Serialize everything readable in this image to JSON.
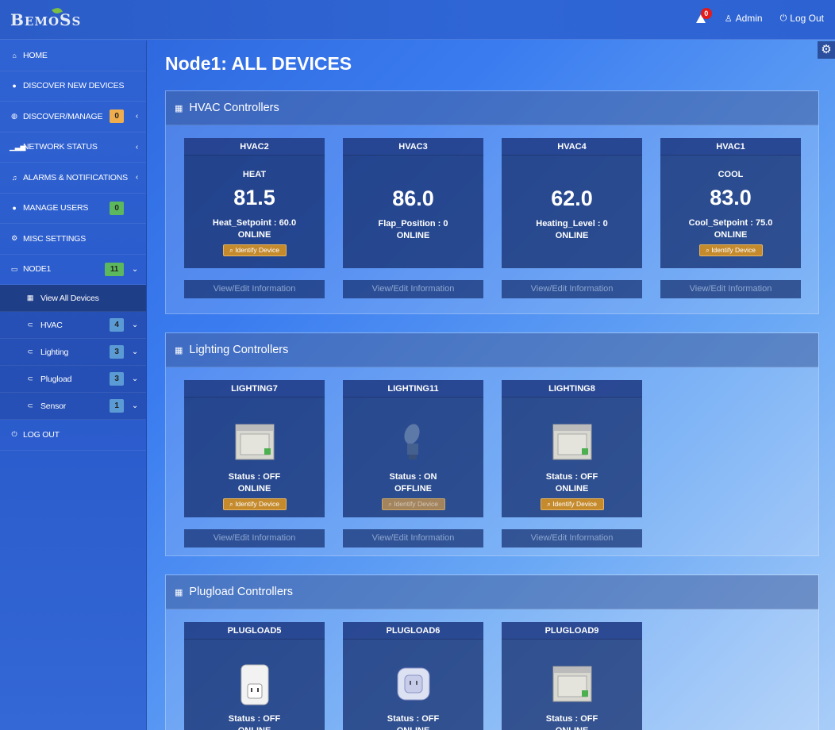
{
  "app": {
    "logo": "BEMOSS",
    "alerts_count": "0",
    "user_label": "Admin",
    "logout_label": "Log Out"
  },
  "sidebar": {
    "items": [
      {
        "label": "HOME"
      },
      {
        "label": "DISCOVER NEW DEVICES"
      },
      {
        "label": "DISCOVER/MANAGE",
        "badge": "0"
      },
      {
        "label": "NETWORK STATUS"
      },
      {
        "label": "ALARMS & NOTIFICATIONS"
      },
      {
        "label": "MANAGE USERS",
        "badge": "0"
      },
      {
        "label": "MISC SETTINGS"
      },
      {
        "label": "NODE1",
        "badge": "11"
      }
    ],
    "sub": [
      {
        "label": "View All Devices"
      },
      {
        "label": "HVAC",
        "badge": "4"
      },
      {
        "label": "Lighting",
        "badge": "3"
      },
      {
        "label": "Plugload",
        "badge": "3"
      },
      {
        "label": "Sensor",
        "badge": "1"
      }
    ],
    "logout": "LOG OUT"
  },
  "main": {
    "title": "Node1: ALL DEVICES",
    "identify_label": "Identify Device",
    "view_label": "View/Edit Information",
    "hvac": {
      "heading": "HVAC Controllers",
      "cards": [
        {
          "name": "HVAC2",
          "mode": "HEAT",
          "temp": "81.5",
          "param": "Heat_Setpoint : 60.0",
          "state": "ONLINE"
        },
        {
          "name": "HVAC3",
          "mode": "",
          "temp": "86.0",
          "param": "Flap_Position : 0",
          "state": "ONLINE"
        },
        {
          "name": "HVAC4",
          "mode": "",
          "temp": "62.0",
          "param": "Heating_Level : 0",
          "state": "ONLINE"
        },
        {
          "name": "HVAC1",
          "mode": "COOL",
          "temp": "83.0",
          "param": "Cool_Setpoint : 75.0",
          "state": "ONLINE"
        }
      ]
    },
    "lighting": {
      "heading": "Lighting Controllers",
      "cards": [
        {
          "name": "LIGHTING7",
          "status": "Status : OFF",
          "state": "ONLINE"
        },
        {
          "name": "LIGHTING11",
          "status": "Status : ON",
          "state": "OFFLINE"
        },
        {
          "name": "LIGHTING8",
          "status": "Status : OFF",
          "state": "ONLINE"
        }
      ]
    },
    "plugload": {
      "heading": "Plugload Controllers",
      "cards": [
        {
          "name": "PLUGLOAD5",
          "status": "Status : OFF",
          "state": "ONLINE"
        },
        {
          "name": "PLUGLOAD6",
          "status": "Status : OFF",
          "state": "ONLINE"
        },
        {
          "name": "PLUGLOAD9",
          "status": "Status : OFF",
          "state": "ONLINE"
        }
      ]
    }
  }
}
